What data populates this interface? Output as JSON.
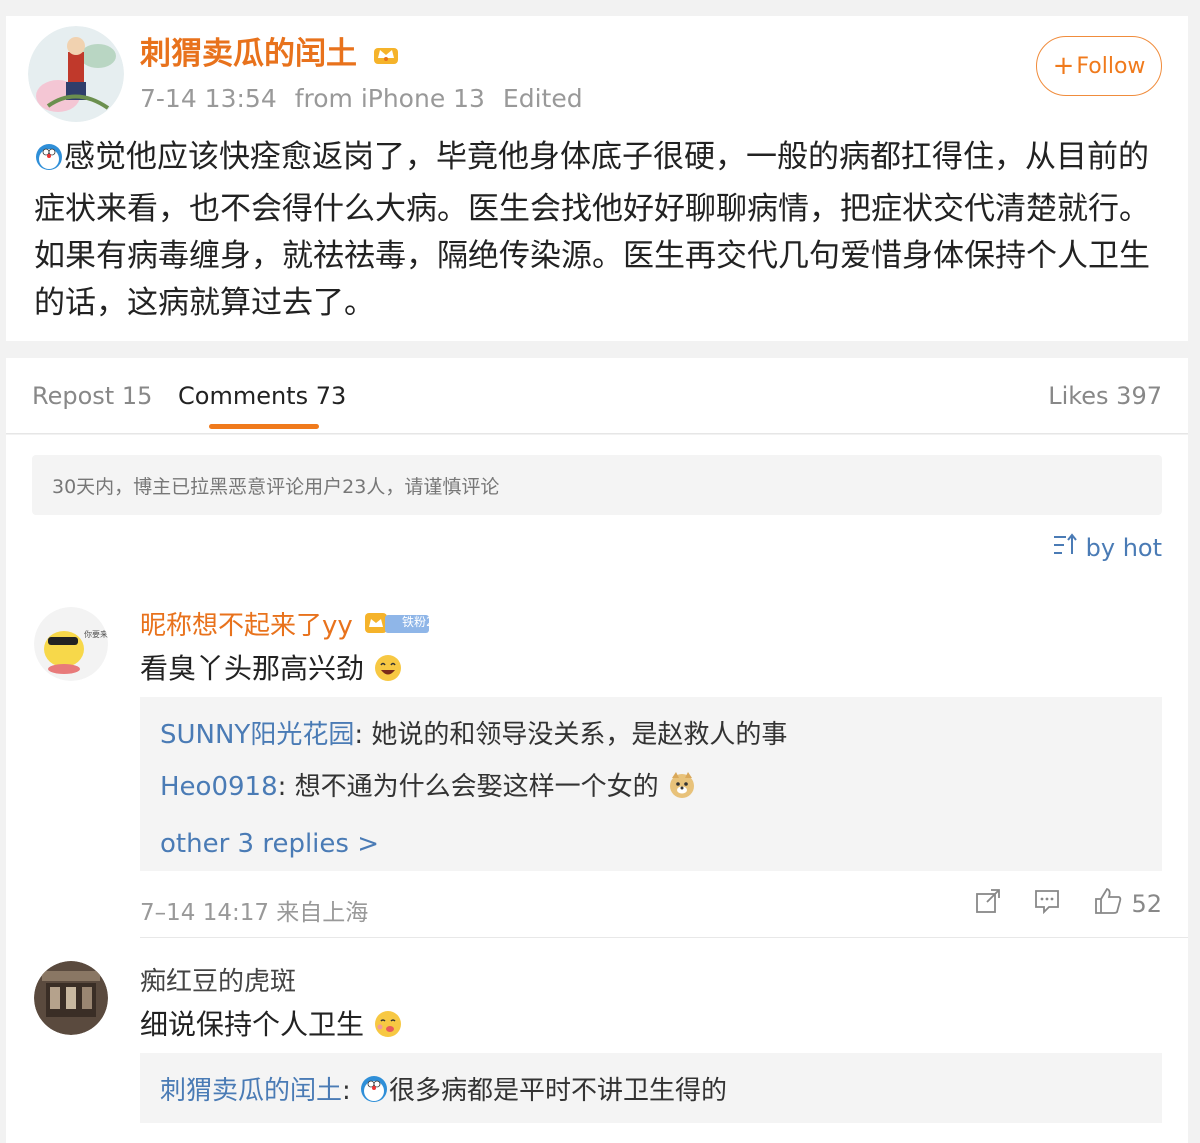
{
  "post": {
    "author": "刺猬卖瓜的闰土",
    "time": "7-14 13:54",
    "source": "from iPhone 13",
    "edited": "Edited",
    "follow_label": "Follow",
    "text": "感觉他应该快痊愈返岗了，毕竟他身体底子很硬，一般的病都扛得住，从目前的症状来看，也不会得什么大病。医生会找他好好聊聊病情，把症状交代清楚就行。如果有病毒缠身，就祛祛毒，隔绝传染源。医生再交代几句爱惜身体保持个人卫生的话，这病就算过去了。"
  },
  "tabs": {
    "repost": "Repost 15",
    "comments": "Comments 73",
    "likes": "Likes 397"
  },
  "notice": "30天内，博主已拉黑恶意评论用户23人，请谨慎评论",
  "sort_label": "by hot",
  "comments": [
    {
      "name": "昵称想不起来了yy",
      "fan_badge": "铁粉2",
      "text": "看臭丫头那高兴劲",
      "replies": [
        {
          "user": "SUNNY阳光花园",
          "text": ": 她说的和领导没关系，是赵救人的事"
        },
        {
          "user": "Heo0918",
          "text": ": 想不通为什么会娶这样一个女的"
        }
      ],
      "more": "other 3 replies >",
      "time": "7–14 14:17 来自上海",
      "likes": "52"
    },
    {
      "name": "痴红豆的虎斑",
      "text": "细说保持个人卫生",
      "replies": [
        {
          "user": "刺猬卖瓜的闰土",
          "text": "很多病都是平时不讲卫生得的"
        }
      ]
    }
  ],
  "colors": {
    "accent_orange": "#e8721c",
    "link_blue": "#4a7bb5"
  }
}
